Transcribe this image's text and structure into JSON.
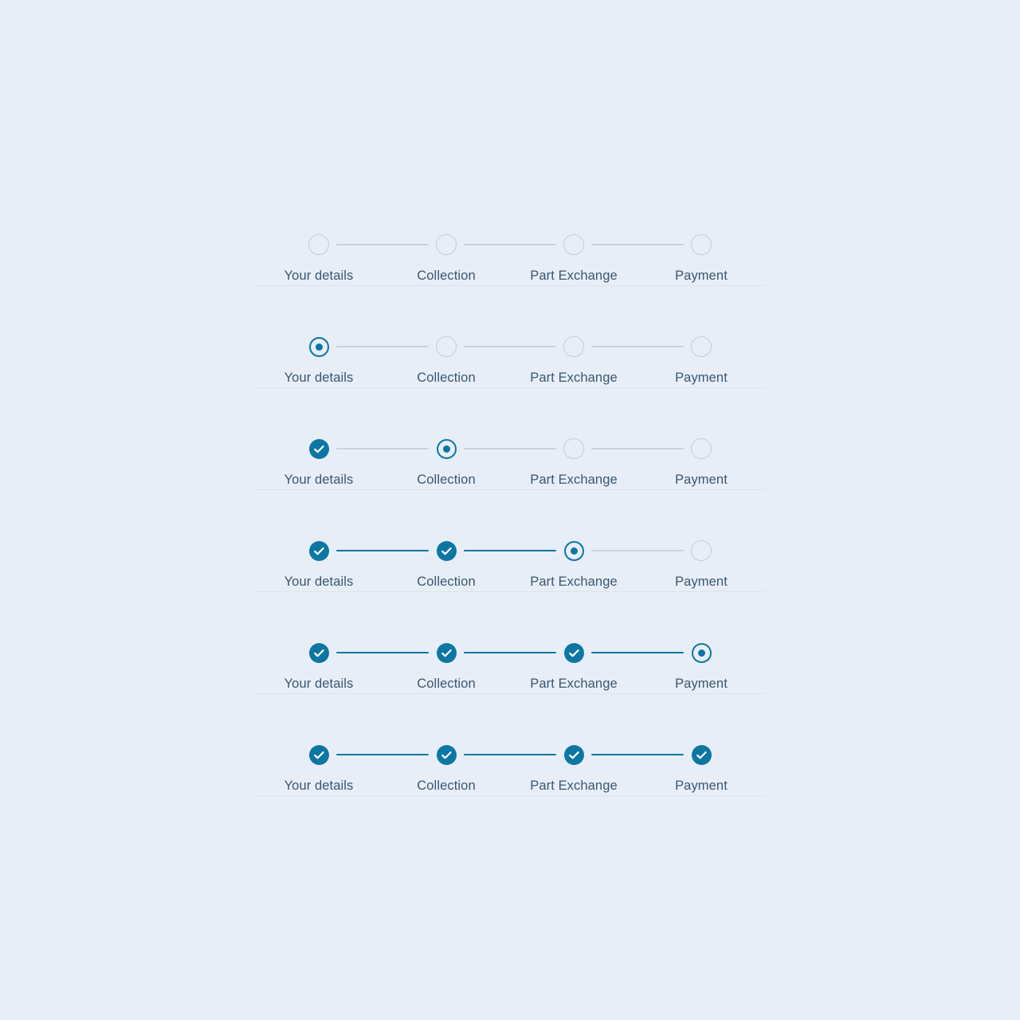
{
  "theme": {
    "background": "#e8eef7",
    "accent": "#0d76a3",
    "pending_line": "#c8d2dc",
    "pending_ring": "#c3cdd8",
    "label_color": "#3a5670",
    "divider_color": "#dbe3ed"
  },
  "steps": {
    "labels": [
      "Your details",
      "Collection",
      "Part Exchange",
      "Payment"
    ]
  },
  "rows": [
    {
      "name": "all-pending",
      "states": [
        "pending",
        "pending",
        "pending",
        "pending"
      ],
      "connectors": [
        "pending",
        "pending",
        "pending"
      ],
      "divider": true
    },
    {
      "name": "step-1-active",
      "states": [
        "active",
        "pending",
        "pending",
        "pending"
      ],
      "connectors": [
        "pending",
        "pending",
        "pending"
      ],
      "divider": true
    },
    {
      "name": "step-2-active",
      "states": [
        "complete",
        "active",
        "pending",
        "pending"
      ],
      "connectors": [
        "pending",
        "pending",
        "pending"
      ],
      "divider": true
    },
    {
      "name": "step-3-active",
      "states": [
        "complete",
        "complete",
        "active",
        "pending"
      ],
      "connectors": [
        "done",
        "done",
        "pending"
      ],
      "divider": true
    },
    {
      "name": "step-4-active",
      "states": [
        "complete",
        "complete",
        "complete",
        "active"
      ],
      "connectors": [
        "done",
        "done",
        "done"
      ],
      "divider": true
    },
    {
      "name": "all-complete",
      "states": [
        "complete",
        "complete",
        "complete",
        "complete"
      ],
      "connectors": [
        "done",
        "done",
        "done"
      ],
      "divider": true
    }
  ],
  "geometry": {
    "row_top_first": 273,
    "row_pitch": 128,
    "step_centers": [
      80,
      240,
      400,
      560
    ],
    "connector_inset": 22
  }
}
